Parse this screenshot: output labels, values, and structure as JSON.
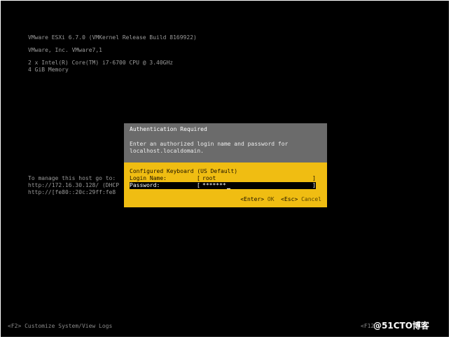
{
  "system_info": {
    "lines": [
      "VMware ESXi 6.7.0 (VMKernel Release Build 8169922)",
      "VMware, Inc. VMware7,1",
      "2 x Intel(R) Core(TM) i7-6700 CPU @ 3.40GHz",
      "4 GiB Memory"
    ]
  },
  "management": {
    "lines": [
      "To manage this host go to:",
      "http://172.16.30.128/ (DHCP)",
      "http://[fe80::20c:29ff:fe8"
    ]
  },
  "dialog": {
    "title": "Authentication Required",
    "message_lines": [
      "Enter an authorized login name and password for",
      "localhost.localdomain."
    ],
    "keyboard_label": "Configured Keyboard (US Default)",
    "login_label": "Login Name:",
    "login_value": "root",
    "password_label": "Password:",
    "password_value": "*******",
    "bracket_open": "[",
    "bracket_close": "]",
    "ok_key": "<Enter>",
    "ok_label": "OK",
    "cancel_key": "<Esc>",
    "cancel_label": "Cancel"
  },
  "footer": {
    "left": "<F2> Customize System/View Logs",
    "right": "<F12"
  },
  "watermark": "@51CTO博客",
  "colors": {
    "background": "#000000",
    "dialog_header": "#6b6b6b",
    "dialog_body": "#f0bd12",
    "text_gray": "#9a9a9a"
  }
}
